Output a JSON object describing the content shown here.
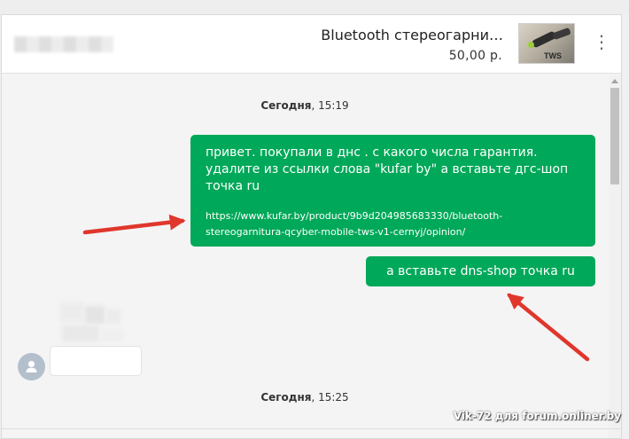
{
  "header": {
    "item_title": "Bluetooth стереогарни…",
    "price": "50,00 р.",
    "thumb_label": "TWS",
    "menu_glyph": "⋮"
  },
  "messages": {
    "date_label_1": {
      "day": "Сегодня",
      "time": ", 15:19"
    },
    "outgoing_1": {
      "text": "привет. покупали в днс . с какого числа гарантия. удалите из ссылки слова \"kufar by\" а вставьте дгс-шоп точка ru",
      "link": "https://www.kufar.by/product/9b9d204985683330/bluetooth-stereogarnitura-qcyber-mobile-tws-v1-cernyj/opinion/"
    },
    "outgoing_2": {
      "text": "а вставьте dns-shop точка ru"
    },
    "date_label_2": {
      "day": "Сегодня",
      "time": ", 15:25"
    }
  },
  "watermark": "Vik-72 для forum.onliner.by",
  "icons": {
    "menu": "kebab-menu-icon",
    "avatar": "user-avatar-icon",
    "arrow": "annotation-arrow"
  },
  "colors": {
    "bubble": "#00a859",
    "arrow": "#e0362c",
    "avatar": "#b3c0cc"
  }
}
